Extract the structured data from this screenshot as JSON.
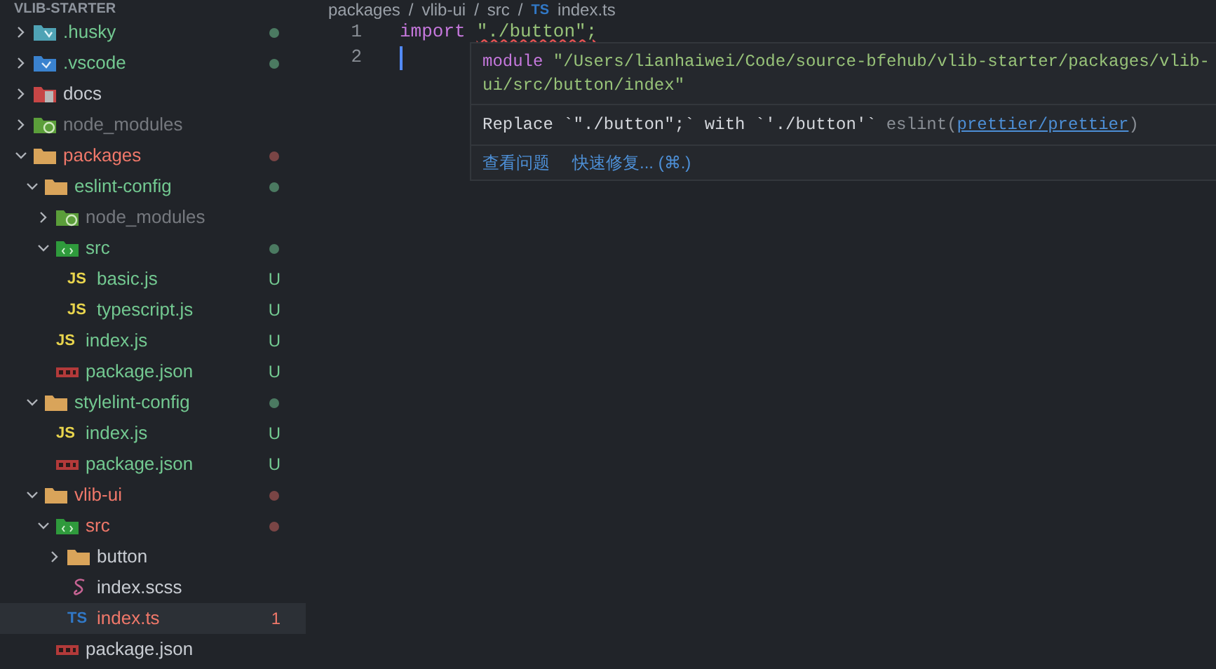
{
  "explorer": {
    "title": "VLIB-STARTER",
    "items": [
      {
        "name": ".husky",
        "kind": "husky_folder",
        "expanded": false,
        "untracked": true,
        "ignored": false,
        "error": false,
        "color": "#4b7a61",
        "selected": false
      },
      {
        "name": ".vscode",
        "kind": "vscode_folder",
        "expanded": false,
        "untracked": true,
        "ignored": false,
        "error": false,
        "color": "#4b7a61",
        "selected": false
      },
      {
        "name": "docs",
        "kind": "docs_folder",
        "expanded": false,
        "untracked": false,
        "ignored": false,
        "error": false,
        "selected": false
      },
      {
        "name": "node_modules",
        "kind": "node_folder",
        "expanded": false,
        "untracked": false,
        "ignored": true,
        "error": false,
        "selected": false
      },
      {
        "name": "packages",
        "kind": "folder",
        "expanded": true,
        "untracked": false,
        "ignored": false,
        "error": true,
        "color": "#7a4545",
        "selected": false,
        "children": [
          {
            "name": "eslint-config",
            "kind": "folder",
            "expanded": true,
            "untracked": true,
            "ignored": false,
            "error": false,
            "color": "#4b7a61",
            "selected": false,
            "children": [
              {
                "name": "node_modules",
                "kind": "node_folder",
                "expanded": false,
                "untracked": false,
                "ignored": true,
                "error": false,
                "selected": false
              },
              {
                "name": "src",
                "kind": "src_folder",
                "expanded": true,
                "untracked": true,
                "ignored": false,
                "error": false,
                "color": "#4b7a61",
                "selected": false,
                "children": [
                  {
                    "name": "basic.js",
                    "kind": "js_file",
                    "icon_label": "JS",
                    "untracked": true,
                    "ignored": false,
                    "error": false,
                    "badge": "U",
                    "selected": false
                  },
                  {
                    "name": "typescript.js",
                    "kind": "js_file",
                    "icon_label": "JS",
                    "untracked": true,
                    "ignored": false,
                    "error": false,
                    "badge": "U",
                    "selected": false
                  }
                ]
              },
              {
                "name": "index.js",
                "kind": "js_file",
                "icon_label": "JS",
                "untracked": true,
                "ignored": false,
                "error": false,
                "badge": "U",
                "selected": false
              },
              {
                "name": "package.json",
                "kind": "npm_file",
                "untracked": true,
                "ignored": false,
                "error": false,
                "badge": "U",
                "selected": false
              }
            ]
          },
          {
            "name": "stylelint-config",
            "kind": "folder",
            "expanded": true,
            "untracked": true,
            "ignored": false,
            "error": false,
            "color": "#4b7a61",
            "selected": false,
            "children": [
              {
                "name": "index.js",
                "kind": "js_file",
                "icon_label": "JS",
                "untracked": true,
                "ignored": false,
                "error": false,
                "badge": "U",
                "selected": false
              },
              {
                "name": "package.json",
                "kind": "npm_file",
                "untracked": true,
                "ignored": false,
                "error": false,
                "badge": "U",
                "selected": false
              }
            ]
          },
          {
            "name": "vlib-ui",
            "kind": "folder",
            "expanded": true,
            "untracked": false,
            "ignored": false,
            "error": true,
            "color": "#7a4545",
            "selected": false,
            "children": [
              {
                "name": "src",
                "kind": "src_folder",
                "expanded": true,
                "untracked": false,
                "ignored": false,
                "error": true,
                "color": "#7a4545",
                "selected": false,
                "children": [
                  {
                    "name": "button",
                    "kind": "folder",
                    "expanded": false,
                    "untracked": false,
                    "ignored": false,
                    "error": false,
                    "selected": false
                  },
                  {
                    "name": "index.scss",
                    "kind": "sass_file",
                    "untracked": false,
                    "ignored": false,
                    "error": false,
                    "selected": false
                  },
                  {
                    "name": "index.ts",
                    "kind": "ts_file",
                    "icon_label": "TS",
                    "untracked": false,
                    "ignored": false,
                    "error": true,
                    "badge": "1",
                    "selected": true
                  }
                ]
              },
              {
                "name": "package.json",
                "kind": "npm_file",
                "untracked": false,
                "ignored": false,
                "error": false,
                "selected": false
              }
            ]
          }
        ]
      }
    ]
  },
  "breadcrumb": {
    "parts": [
      {
        "kind": "item",
        "text": "packages"
      },
      {
        "kind": "separator",
        "text": "/"
      },
      {
        "kind": "item",
        "text": "vlib-ui"
      },
      {
        "kind": "separator",
        "text": "/"
      },
      {
        "kind": "item",
        "text": "src"
      },
      {
        "kind": "separator",
        "text": "/"
      },
      {
        "kind": "icon",
        "text": "TS"
      },
      {
        "kind": "item",
        "text": "index.ts"
      }
    ]
  },
  "editor": {
    "lines": [
      {
        "number": "1",
        "cursor": false,
        "tokens": [
          {
            "kind": "keyword",
            "text": "import",
            "squiggle": false
          },
          {
            "kind": "string",
            "text": "\"./button\";",
            "squiggle": true
          }
        ]
      },
      {
        "number": "2",
        "cursor": true
      }
    ]
  },
  "hover": {
    "keyword": "module",
    "path": "\"/Users/lianhaiwei/Code/source-bfehub/vlib-starter/packages/vlib-ui/src/button/index\"",
    "message": "Replace `\"./button\";` with `'./button'`",
    "source": "eslint(",
    "link": "prettier/prettier",
    "source_end": ")",
    "actions": [
      "查看问题",
      "快速修复... (⌘.)"
    ]
  }
}
